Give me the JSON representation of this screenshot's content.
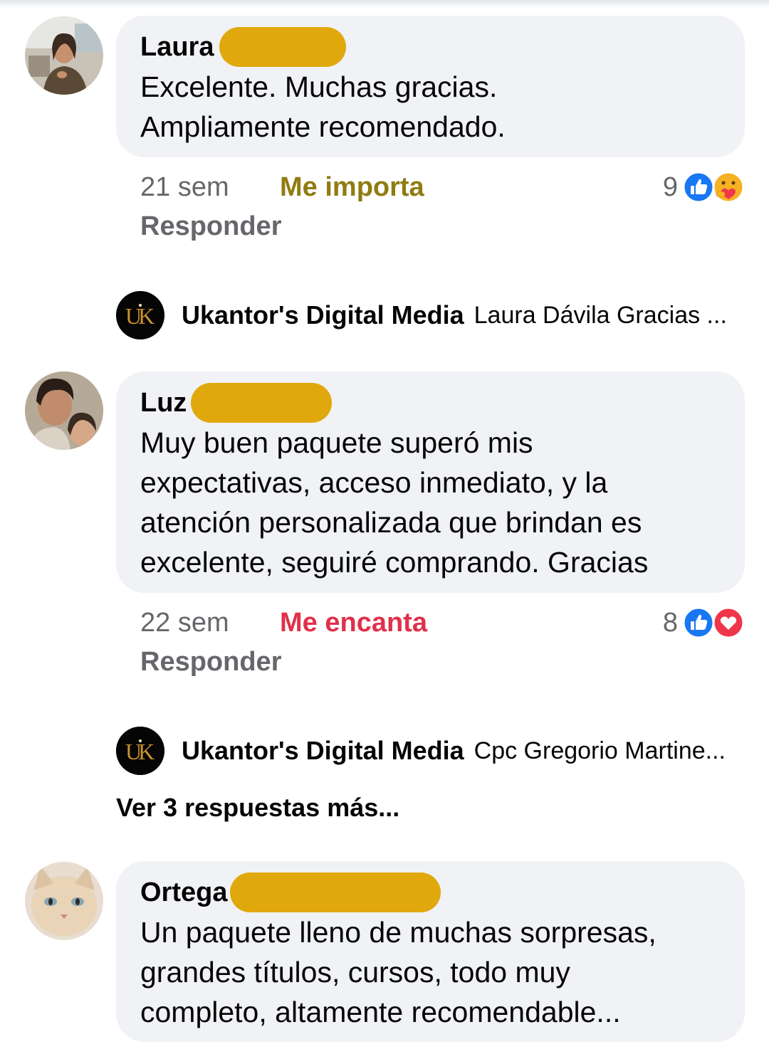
{
  "colors": {
    "bubble_bg": "#f0f2f5",
    "redaction": "#e0a80c",
    "care_reaction": "#8f7c10",
    "love_reaction": "#e0304a",
    "meta_text": "#65676b",
    "like_blue": "#1877f2"
  },
  "comments": [
    {
      "author": "Laura",
      "text": "Excelente. Muchas gracias.\nAmpliamente recomendado.",
      "time": "21 sem",
      "reaction_label": "Me importa",
      "reaction_count": "9",
      "reaction_icons": [
        "like-icon",
        "care-icon"
      ],
      "reply": "Responder",
      "page_reply": {
        "page": "Ukantor's Digital Media",
        "snippet": "Laura Dávila Gracias ..."
      }
    },
    {
      "author": "Luz",
      "text": "Muy buen paquete superó mis\nexpectativas, acceso inmediato, y la\natención personalizada que brindan es\nexcelente, seguiré comprando. Gracias",
      "time": "22 sem",
      "reaction_label": "Me encanta",
      "reaction_count": "8",
      "reaction_icons": [
        "like-icon",
        "love-icon"
      ],
      "reply": "Responder",
      "page_reply": {
        "page": "Ukantor's Digital Media",
        "snippet": "Cpc Gregorio Martine..."
      },
      "more_replies": "Ver 3 respuestas más..."
    },
    {
      "author": "Ortega",
      "text": "Un paquete lleno de muchas sorpresas,\ngrandes títulos, cursos, todo muy\ncompleto, altamente recomendable..."
    }
  ]
}
